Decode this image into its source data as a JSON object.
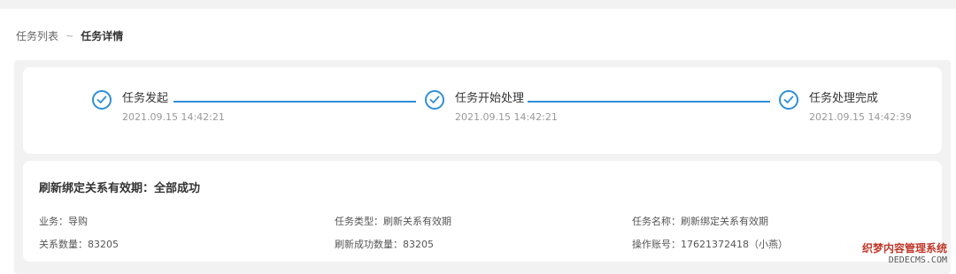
{
  "breadcrumb": {
    "parent": "任务列表",
    "separator": "~",
    "current": "任务详情"
  },
  "steps": [
    {
      "title": "任务发起",
      "time": "2021.09.15 14:42:21",
      "icon": "check-circle-icon"
    },
    {
      "title": "任务开始处理",
      "time": "2021.09.15 14:42:21",
      "icon": "check-circle-icon"
    },
    {
      "title": "任务处理完成",
      "time": "2021.09.15 14:42:39",
      "icon": "check-circle-icon"
    }
  ],
  "info": {
    "title": "刷新绑定关系有效期：全部成功",
    "fields": [
      {
        "label": "业务：",
        "value": "导购"
      },
      {
        "label": "任务类型：",
        "value": "刷新关系有效期"
      },
      {
        "label": "任务名称：",
        "value": "刷新绑定关系有效期"
      },
      {
        "label": "关系数量：",
        "value": "83205"
      },
      {
        "label": "刷新成功数量：",
        "value": "83205"
      },
      {
        "label": "操作账号：",
        "value": "17621372418（小燕）"
      }
    ]
  },
  "watermark": {
    "line1": "织梦内容管理系统",
    "line2": "DEDECMS.COM"
  },
  "colors": {
    "accent": "#2f8fd8",
    "background": "#f2f2f2",
    "card": "#ffffff"
  }
}
